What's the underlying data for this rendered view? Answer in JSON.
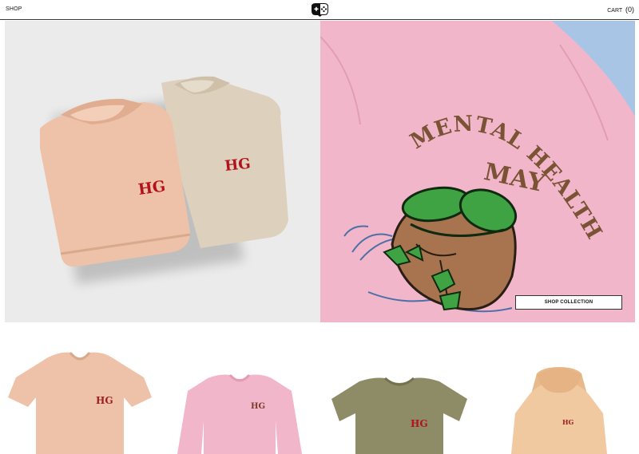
{
  "header": {
    "shop_label": "SHOP",
    "cart_label": "CART",
    "cart_count": "(0)",
    "logo_icon": "gamepad-logo-icon"
  },
  "hero": {
    "left_image": {
      "shirt_print": "HG",
      "subject": "folded-tshirts"
    },
    "right_image": {
      "line1": "MENTAL HEALTH",
      "line2": "MAY",
      "subject": "frog-character-sweatshirt"
    },
    "cta_label": "SHOP COLLECTION"
  },
  "products": [
    {
      "print": "HG",
      "type": "tshirt"
    },
    {
      "print": "HG",
      "type": "sweatshirt"
    },
    {
      "print": "HG",
      "type": "crop-tee"
    },
    {
      "print": "HG",
      "type": "hoodie"
    }
  ],
  "colors": {
    "peach": "#eec2a8",
    "tan": "#ddd0bd",
    "pink": "#f2b6cb",
    "olive": "#8d8c66",
    "hoodie": "#f0c9a0",
    "print_red": "#b3121d",
    "brown": "#7a5234",
    "frog_green": "#3fa243",
    "sky": "#a8c5e6"
  }
}
